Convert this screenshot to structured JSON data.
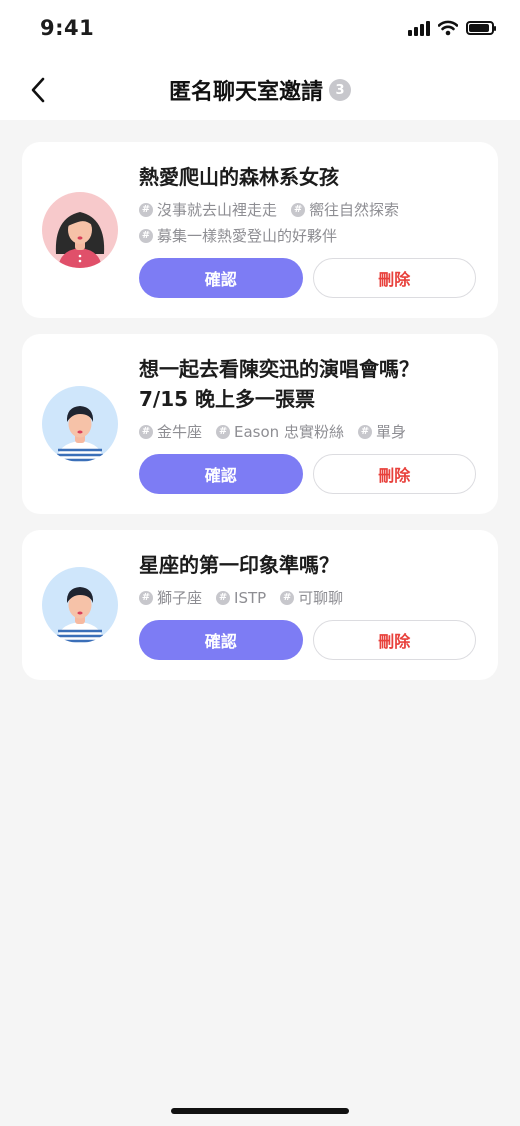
{
  "status_bar": {
    "time": "9:41"
  },
  "header": {
    "title": "匿名聊天室邀請",
    "count": "3",
    "back_icon": "chevron-left-icon"
  },
  "colors": {
    "accent": "#7d7cf4",
    "danger": "#e8413c",
    "tag_gray": "#8e8e93"
  },
  "invitations": [
    {
      "avatar": "female-avatar",
      "title_lines": [
        "熱愛爬山的森林系女孩"
      ],
      "tags": [
        "沒事就去山裡走走",
        "嚮往自然探索",
        "募集一樣熱愛登山的好夥伴"
      ],
      "confirm_label": "確認",
      "delete_label": "刪除"
    },
    {
      "avatar": "male-avatar",
      "title_lines": [
        "想一起去看陳奕迅的演唱會嗎？",
        "7/15 晚上多一張票"
      ],
      "tags": [
        "金牛座",
        "Eason 忠實粉絲",
        "單身"
      ],
      "confirm_label": "確認",
      "delete_label": "刪除"
    },
    {
      "avatar": "male-avatar",
      "title_lines": [
        "星座的第一印象準嗎？"
      ],
      "tags": [
        "獅子座",
        "ISTP",
        "可聊聊"
      ],
      "confirm_label": "確認",
      "delete_label": "刪除"
    }
  ]
}
